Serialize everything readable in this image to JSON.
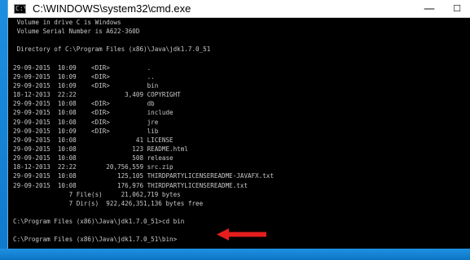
{
  "window": {
    "title": "C:\\WINDOWS\\system32\\cmd.exe",
    "icon": "cmd-console-icon",
    "minimize_glyph": "—",
    "maximize_glyph": "☐"
  },
  "console": {
    "lines": [
      " Volume in drive C is Windows",
      " Volume Serial Number is A622-360D",
      "",
      " Directory of C:\\Program Files (x86)\\Java\\jdk1.7.0_51",
      "",
      "29-09-2015  10:09    <DIR>          .",
      "29-09-2015  10:09    <DIR>          ..",
      "29-09-2015  10:09    <DIR>          bin",
      "18-12-2013  22:22             3,409 COPYRIGHT",
      "29-09-2015  10:08    <DIR>          db",
      "29-09-2015  10:08    <DIR>          include",
      "29-09-2015  10:08    <DIR>          jre",
      "29-09-2015  10:09    <DIR>          lib",
      "29-09-2015  10:08                41 LICENSE",
      "29-09-2015  10:08               123 README.html",
      "29-09-2015  10:08               508 release",
      "18-12-2013  22:22        20,756,559 src.zip",
      "29-09-2015  10:08           125,105 THIRDPARTYLICENSEREADME-JAVAFX.txt",
      "29-09-2015  10:08           176,976 THIRDPARTYLICENSEREADME.txt",
      "               7 File(s)     21,062,719 bytes",
      "               7 Dir(s)  922,426,351,136 bytes free",
      "",
      "C:\\Program Files (x86)\\Java\\jdk1.7.0_51>cd bin",
      "",
      "C:\\Program Files (x86)\\Java\\jdk1.7.0_51\\bin>"
    ]
  },
  "annotation": {
    "icon": "red-arrow-icon",
    "color": "#e51d1d"
  },
  "colors": {
    "console_background": "#000000",
    "console_text": "#c9c9c9",
    "titlebar": "#ffffff",
    "desktop": "#1383d6"
  }
}
